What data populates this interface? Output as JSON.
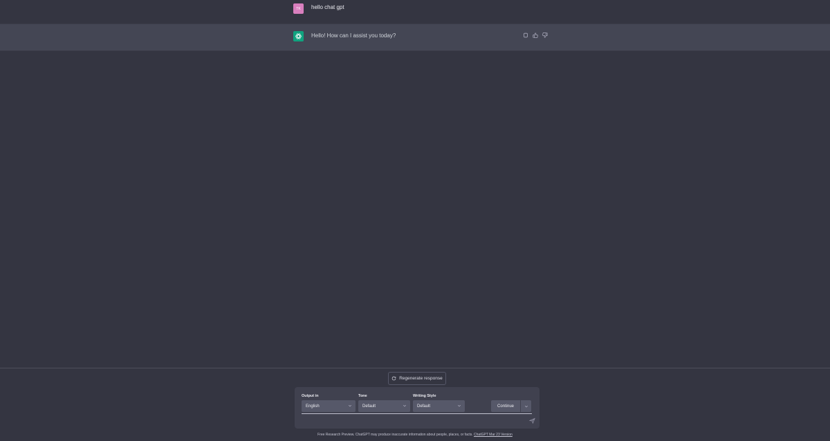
{
  "conversation": {
    "user_message": {
      "avatar_initials": "TK",
      "text": "hello chat gpt",
      "avatar_color": "#d97fbe"
    },
    "assistant_message": {
      "text": "Hello! How can I assist you today?",
      "avatar_color": "#10a37f",
      "actions": [
        "copy-icon",
        "thumbs-up-icon",
        "thumbs-down-icon"
      ]
    }
  },
  "composer": {
    "regenerate_label": "Regenerate response",
    "output_in": {
      "label": "Output in",
      "value": "English"
    },
    "tone": {
      "label": "Tone",
      "value": "Default"
    },
    "writing_style": {
      "label": "Writing Style",
      "value": "Default"
    },
    "continue_label": "Continue",
    "prompt_placeholder": ""
  },
  "footer": {
    "text": "Free Research Preview. ChatGPT may produce inaccurate information about people, places, or facts.",
    "link": "ChatGPT Mar 23 Version"
  },
  "colors": {
    "background": "#343541",
    "assistant_row": "#444654",
    "accent": "#10a37f"
  }
}
